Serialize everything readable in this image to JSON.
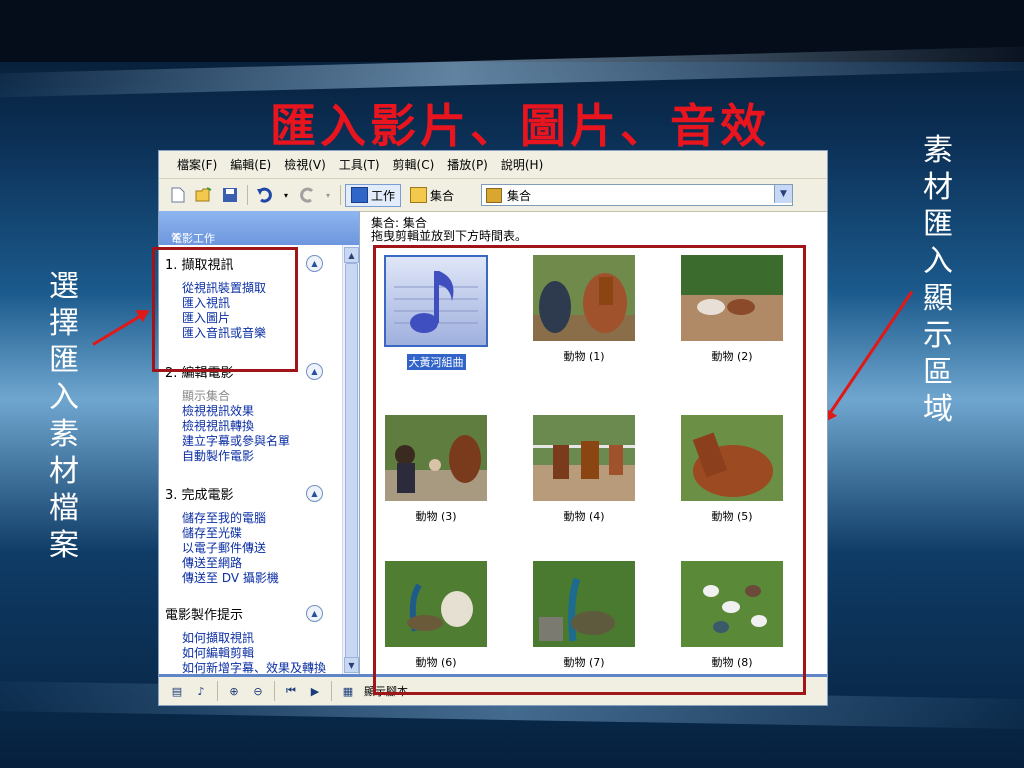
{
  "slide": {
    "title": "匯入影片、圖片、音效",
    "left_annotation": "選擇匯入素材檔案",
    "right_annotation": "素材匯入顯示區域"
  },
  "menubar": {
    "items": [
      "檔案(F)",
      "編輯(E)",
      "檢視(V)",
      "工具(T)",
      "剪輯(C)",
      "播放(P)",
      "說明(H)"
    ]
  },
  "toolbar": {
    "tasks_label": "工作",
    "collections_label": "集合",
    "collection_select": "集合"
  },
  "taskpane": {
    "header": "電影工作",
    "close": "×",
    "sections": [
      {
        "title": "1. 擷取視訊",
        "links": [
          "從視訊裝置擷取",
          "匯入視訊",
          "匯入圖片",
          "匯入音訊或音樂"
        ]
      },
      {
        "title": "2. 編輯電影",
        "links": [
          "顯示集合",
          "檢視視訊效果",
          "檢視視訊轉換",
          "建立字幕或參與名單",
          "自動製作電影"
        ]
      },
      {
        "title": "3. 完成電影",
        "links": [
          "儲存至我的電腦",
          "儲存至光碟",
          "以電子郵件傳送",
          "傳送至網路",
          "傳送至 DV 攝影機"
        ]
      },
      {
        "title": "電影製作提示",
        "links": [
          "如何擷取視訊",
          "如何編輯剪輯",
          "如何新增字幕、效果及轉換"
        ]
      }
    ]
  },
  "collection": {
    "title": "集合: 集合",
    "hint": "拖曳剪輯並放到下方時間表。",
    "clips": [
      {
        "label": "大黃河組曲",
        "kind": "audio",
        "selected": true
      },
      {
        "label": "動物 (1)",
        "kind": "horse"
      },
      {
        "label": "動物 (2)",
        "kind": "horses-field"
      },
      {
        "label": "動物 (3)",
        "kind": "crowd"
      },
      {
        "label": "動物 (4)",
        "kind": "horses-fence"
      },
      {
        "label": "動物 (5)",
        "kind": "horse-close"
      },
      {
        "label": "動物 (6)",
        "kind": "peacock"
      },
      {
        "label": "動物 (7)",
        "kind": "peacock2"
      },
      {
        "label": "動物 (8)",
        "kind": "birds"
      }
    ]
  },
  "statusbar": {
    "storyboard_label": "顯示腳本"
  }
}
